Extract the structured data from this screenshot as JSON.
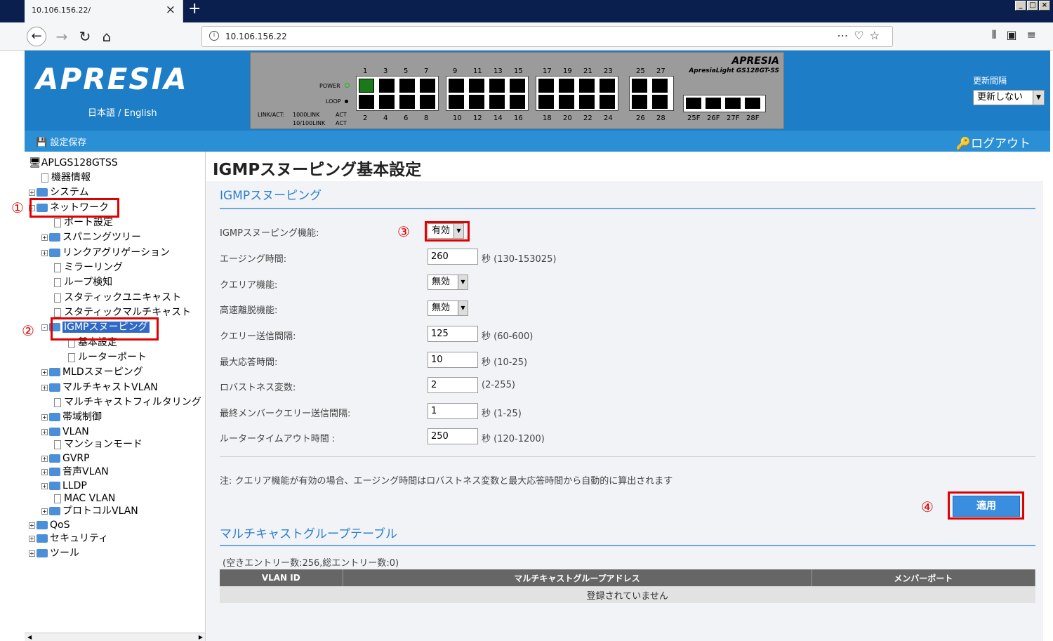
{
  "browser": {
    "tab_title": "10.106.156.22/",
    "tab_close": "×",
    "new_tab": "+",
    "url": "10.106.156.22",
    "window_controls": [
      "_",
      "□",
      "×"
    ],
    "icons": [
      "back-arrow-icon",
      "forward-arrow-icon",
      "reload-icon",
      "home-icon",
      "info-icon",
      "more-icon",
      "pocket-icon",
      "star-icon",
      "library-icon",
      "sidebar-icon",
      "menu-icon"
    ]
  },
  "header": {
    "logo": "APRESIA",
    "lang": "日本語 / English",
    "panel_brand": "APRESIA",
    "panel_model": "ApresiaLight GS128GT-SS",
    "power_label": "POWER",
    "loop_label": "LOOP",
    "linkact_label": "LINK/ACT:",
    "link1000": "1000LINK",
    "link100": "10/100LINK",
    "act1": "ACT",
    "act2": "ACT",
    "top_ports": [
      "1",
      "3",
      "5",
      "7",
      "9",
      "11",
      "13",
      "15",
      "17",
      "19",
      "21",
      "23",
      "25",
      "27"
    ],
    "bottom_ports": [
      "2",
      "4",
      "6",
      "8",
      "10",
      "12",
      "14",
      "16",
      "18",
      "20",
      "22",
      "24",
      "26",
      "28"
    ],
    "sfp_ports": [
      "25F",
      "26F",
      "27F",
      "28F"
    ],
    "refresh_label": "更新間隔",
    "refresh_value": "更新しない",
    "save_label": "設定保存",
    "logout_label": "ログアウト"
  },
  "sidebar": {
    "root": "APLGS128GTSS",
    "items": {
      "device_info": "機器情報",
      "system": "システム",
      "network": "ネットワーク",
      "port_settings": "ポート設定",
      "spanning_tree": "スパニングツリー",
      "link_aggregation": "リンクアグリゲーション",
      "mirroring": "ミラーリング",
      "loop_detect": "ループ検知",
      "static_unicast": "スタティックユニキャスト",
      "static_multicast": "スタティックマルチキャスト",
      "igmp_snooping": "IGMPスヌーピング",
      "basic_settings": "基本設定",
      "router_port": "ルーターポート",
      "mld_snooping": "MLDスヌーピング",
      "multicast_vlan": "マルチキャストVLAN",
      "multicast_filtering": "マルチキャストフィルタリング",
      "bandwidth": "帯域制御",
      "vlan": "VLAN",
      "mansion_mode": "マンションモード",
      "gvrp": "GVRP",
      "voice_vlan": "音声VLAN",
      "lldp": "LLDP",
      "mac_vlan": "MAC VLAN",
      "protocol_vlan": "プロトコルVLAN",
      "qos": "QoS",
      "security": "セキュリティ",
      "tools": "ツール"
    }
  },
  "annotations": {
    "c1": "①",
    "c2": "②",
    "c3": "③",
    "c4": "④"
  },
  "main": {
    "page_title": "IGMPスヌーピング基本設定",
    "section1": "IGMPスヌーピング",
    "fields": {
      "igmp_func_label": "IGMPスヌーピング機能:",
      "igmp_func_value": "有効",
      "aging_label": "エージング時間:",
      "aging_value": "260",
      "aging_unit": "秒 (130-153025)",
      "querier_label": "クエリア機能:",
      "querier_value": "無効",
      "fastleave_label": "高速離脱機能:",
      "fastleave_value": "無効",
      "query_interval_label": "クエリー送信間隔:",
      "query_interval_value": "125",
      "query_interval_unit": "秒 (60-600)",
      "max_resp_label": "最大応答時間:",
      "max_resp_value": "10",
      "max_resp_unit": "秒 (10-25)",
      "robustness_label": "ロバストネス変数:",
      "robustness_value": "2",
      "robustness_unit": "(2-255)",
      "last_member_label": "最終メンバークエリー送信間隔:",
      "last_member_value": "1",
      "last_member_unit": "秒 (1-25)",
      "router_timeout_label": "ルータータイムアウト時間 :",
      "router_timeout_value": "250",
      "router_timeout_unit": "秒 (120-1200)"
    },
    "note": "注: クエリア機能が有効の場合、エージング時間はロバストネス変数と最大応答時間から自動的に算出されます",
    "apply_label": "適用",
    "section2": "マルチキャストグループテーブル",
    "entries": "(空きエントリー数:256,総エントリー数:0)",
    "table": {
      "headers": [
        "VLAN ID",
        "マルチキャストグループアドレス",
        "メンバーポート"
      ],
      "empty": "登録されていません"
    }
  }
}
